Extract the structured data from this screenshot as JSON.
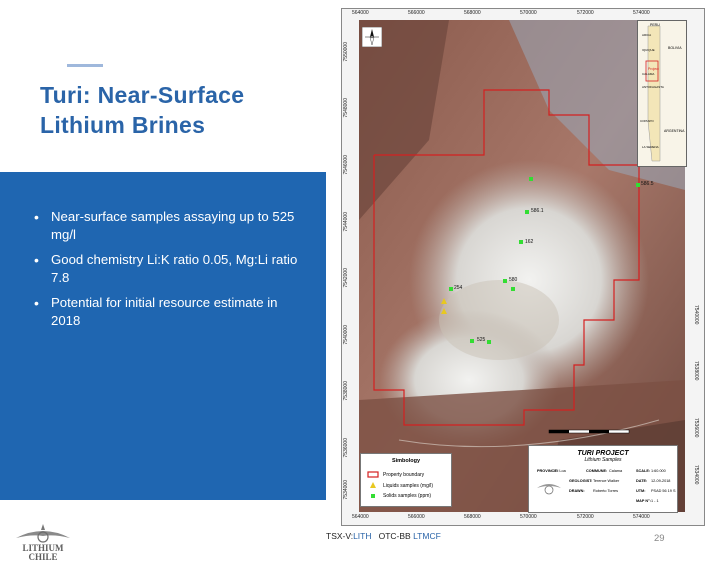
{
  "slide": {
    "title_lines": [
      "Turi: Near-Surface",
      "Lithium Brines"
    ],
    "bullets": [
      "Near-surface samples assaying up to 525 mg/l",
      "Good chemistry Li:K ratio 0.05, Mg:Li  ratio 7.8",
      "Potential for initial resource estimate in 2018"
    ],
    "page_number": "29"
  },
  "footer": {
    "ticker_tsx_prefix": "TSX-V:",
    "ticker_tsx": "LITH",
    "ticker_otc_prefix": "OTC-BB ",
    "ticker_otc": "LTMCF",
    "logo_text_1": "LITHIUM",
    "logo_text_2": "CHILE"
  },
  "map": {
    "x_ticks": [
      "564000",
      "566000",
      "568000",
      "570000",
      "572000",
      "574000"
    ],
    "y_ticks": [
      "7550000",
      "7548000",
      "7546000",
      "7544000",
      "7542000",
      "7540000",
      "7538000",
      "7536000",
      "7534000"
    ],
    "sample_labels": [
      "586.1",
      "525",
      "254",
      "162",
      "580",
      "586.5"
    ],
    "legend": {
      "title": "Simbology",
      "items": [
        "Property boundary",
        "Liquids samples (mg/l)",
        "Solids samples (ppm)"
      ]
    },
    "title_block": {
      "project": "TURI PROJECT",
      "subtitle": "Lithium Samples",
      "rows": [
        [
          "PROVINCE:",
          "El Loa",
          "COMMUNE:",
          "Calama",
          "SCALE:",
          "1:60.000"
        ],
        [
          "GEOLOGIST:",
          "Terence Walker",
          "",
          "",
          "DATE:",
          "12-09-2018"
        ],
        [
          "DRAWN:",
          "Roberto Torres",
          "",
          "",
          "UTM:",
          "PSAD 56 19 S"
        ],
        [
          "",
          "",
          "",
          "",
          "MAP N°:",
          "1 - 1"
        ]
      ]
    },
    "inset_labels": [
      "PERU",
      "BOLIVIA",
      "ARGENTINA",
      "Project",
      "CALAMA",
      "ANTOFAGASTA",
      "COPIAPO",
      "LA SERENA",
      "ARICA",
      "IQUIQUE"
    ],
    "colors": {
      "boundary": "#d42020",
      "solids": "#33dd33",
      "liquids": "#e8c820"
    }
  }
}
